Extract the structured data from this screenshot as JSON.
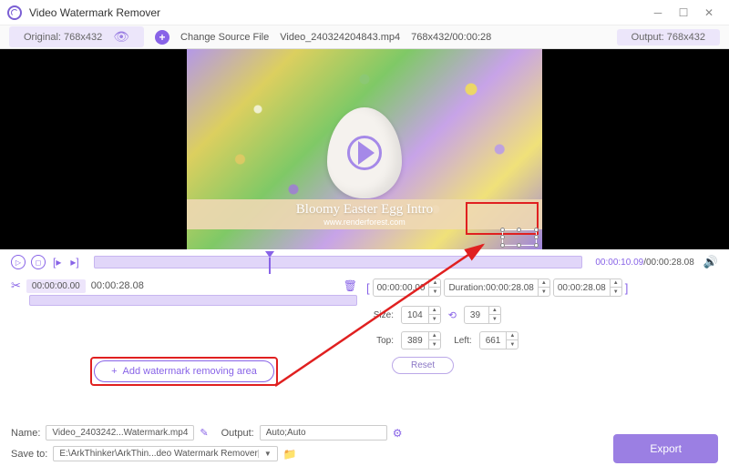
{
  "app": {
    "title": "Video Watermark Remover"
  },
  "toolbar": {
    "original": "Original: 768x432",
    "change_source": "Change Source File",
    "filename": "Video_240324204843.mp4",
    "meta": "768x432/00:00:28",
    "output": "Output: 768x432"
  },
  "preview": {
    "intro_title": "Bloomy Easter Egg Intro",
    "intro_url": "www.renderforest.com"
  },
  "timeline": {
    "current": "00:00:10.09",
    "total": "/00:00:28.08"
  },
  "segment": {
    "start": "00:00:00.00",
    "end": "00:00:28.08"
  },
  "trim": {
    "start": "00:00:00.00",
    "duration_label": "Duration:",
    "duration": "00:00:28.08",
    "end": "00:00:28.08"
  },
  "props": {
    "size_label": "Size:",
    "width": "104",
    "height": "39",
    "top_label": "Top:",
    "top": "389",
    "left_label": "Left:",
    "left": "661",
    "reset": "Reset"
  },
  "actions": {
    "add_area": "Add watermark removing area"
  },
  "bottom": {
    "name_label": "Name:",
    "name_value": "Video_2403242...Watermark.mp4",
    "output_label": "Output:",
    "output_value": "Auto;Auto",
    "saveto_label": "Save to:",
    "saveto_value": "E:\\ArkThinker\\ArkThin...deo Watermark Remover",
    "export": "Export"
  }
}
